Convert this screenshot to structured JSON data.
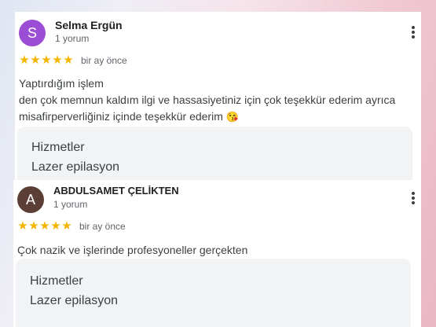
{
  "colors": {
    "star": "#f4b400",
    "avatar_1": "#9c4dd6",
    "avatar_2": "#5b3f36"
  },
  "reviews": [
    {
      "avatar_letter": "S",
      "name": "Selma Ergün",
      "meta": "1 yorum",
      "stars": [
        "★",
        "★",
        "★",
        "★",
        "★"
      ],
      "rating": 5,
      "time": "bir ay önce",
      "text_lines": [
        "Yaptırdığım işlem",
        "den çok memnun kaldım ilgi ve hassasiyetiniz için çok teşekkür ederim ayrıca",
        "misafirperverliğiniz içinde teşekkür ederim"
      ],
      "emoji": "😘",
      "services_title": "Hizmetler",
      "services_value": "Lazer epilasyon"
    },
    {
      "avatar_letter": "A",
      "name": "ABDULSAMET ÇELİKTEN",
      "meta": "1 yorum",
      "stars": [
        "★",
        "★",
        "★",
        "★",
        "★"
      ],
      "rating": 5,
      "time": "bir ay önce",
      "text_lines": [
        "Çok nazik ve işlerinde profesyoneller gerçekten"
      ],
      "services_title": "Hizmetler",
      "services_value": "Lazer epilasyon"
    }
  ]
}
